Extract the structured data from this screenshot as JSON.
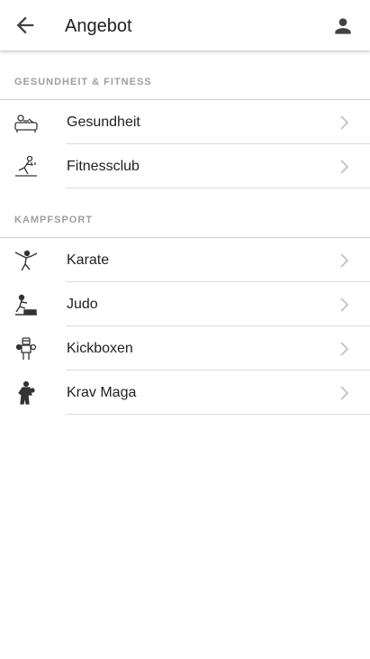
{
  "appbar": {
    "title": "Angebot",
    "back_icon": "arrow-back-icon",
    "profile_icon": "person-icon"
  },
  "sections": [
    {
      "header": "GESUNDHEIT & FITNESS",
      "items": [
        {
          "label": "Gesundheit",
          "icon": "health-icon"
        },
        {
          "label": "Fitnessclub",
          "icon": "fitness-icon"
        }
      ]
    },
    {
      "header": "KAMPFSPORT",
      "items": [
        {
          "label": "Karate",
          "icon": "karate-icon"
        },
        {
          "label": "Judo",
          "icon": "judo-icon"
        },
        {
          "label": "Kickboxen",
          "icon": "kickboxing-icon"
        },
        {
          "label": "Krav Maga",
          "icon": "krav-maga-icon"
        }
      ]
    }
  ],
  "colors": {
    "text": "#212121",
    "section_header": "#9e9e9e",
    "chevron": "#bdbdbd",
    "divider": "#dcdcdc"
  }
}
